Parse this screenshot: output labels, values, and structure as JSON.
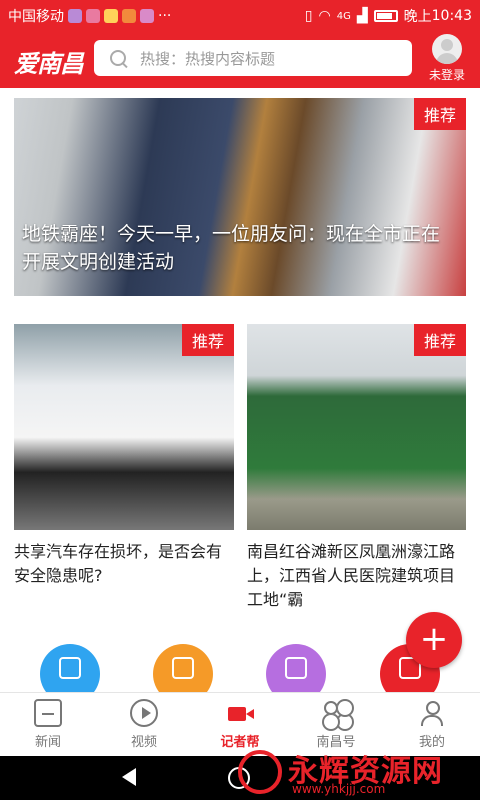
{
  "status_bar": {
    "carrier": "中国移动",
    "time_prefix": "晚上",
    "time": "10:43",
    "signal": "4G"
  },
  "header": {
    "logo": "爱南昌",
    "search_placeholder": "热搜：热搜内容标题",
    "login_label": "未登录"
  },
  "feed": [
    {
      "tag": "推荐",
      "caption": "地铁霸座！今天一早，一位朋友问：现在全市正在开展文明创建活动"
    },
    {
      "tag": "推荐",
      "title": "共享汽车存在损坏，是否会有安全隐患呢?"
    },
    {
      "tag": "推荐",
      "title": "南昌红谷滩新区凤凰洲濠江路上，江西省人民医院建筑项目工地“霸"
    }
  ],
  "fab_label": "+",
  "tabs": [
    {
      "label": "新闻",
      "icon": "news-icon"
    },
    {
      "label": "视频",
      "icon": "video-icon"
    },
    {
      "label": "记者帮",
      "icon": "camera-icon"
    },
    {
      "label": "南昌号",
      "icon": "grid-icon"
    },
    {
      "label": "我的",
      "icon": "user-icon"
    }
  ],
  "watermark": {
    "title": "永辉资源网",
    "url": "www.yhkjjj.com"
  },
  "colors": {
    "accent": "#e8232a"
  }
}
